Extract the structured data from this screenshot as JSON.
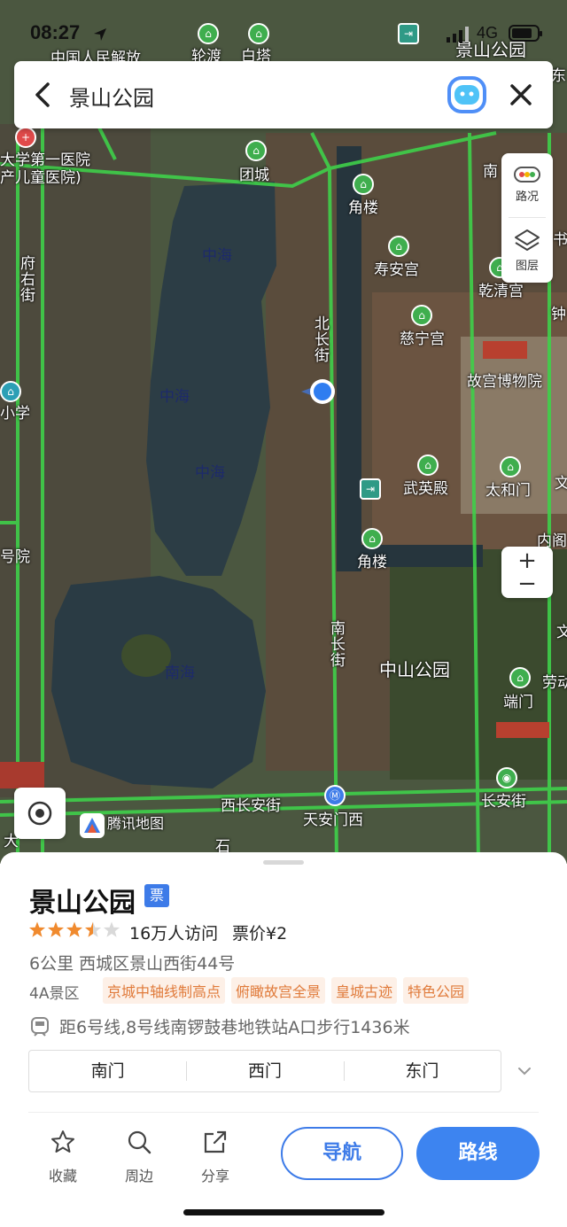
{
  "status_bar": {
    "time": "08:27",
    "network": "4G"
  },
  "search": {
    "query": "景山公园"
  },
  "map_controls": {
    "traffic_label": "路况",
    "layers_label": "图层",
    "zoom_in": "+",
    "zoom_out": "−"
  },
  "map": {
    "watermark": "腾讯地图",
    "labels": {
      "top1": "中国人民解放",
      "top2": "轮渡",
      "top3": "白塔",
      "top4": "景山公园",
      "top_right": "东",
      "hospital": "大学第一医院",
      "hospital2": "产儿童医院)",
      "tuancheng": "团城",
      "fuyou": "府右街",
      "school": "小学",
      "hao": "号院",
      "zhonghai1": "中海",
      "zhonghai2": "中海",
      "zhonghai3": "中海",
      "nanhai": "南海",
      "beichang": "北长街",
      "nanchang": "南长街",
      "jiaolou1": "角楼",
      "jiaolou2": "角楼",
      "shouan": "寿安宫",
      "qianqing": "乾清宫",
      "cining": "慈宁宫",
      "palace": "故宫博物院",
      "wuying": "武英殿",
      "taihe": "太和门",
      "zhongshan": "中山公园",
      "duanmen": "端门",
      "xichangan": "西长安街",
      "tiananmen_w": "天安门西",
      "changan": "长安街",
      "nan": "南",
      "shu": "书",
      "zhong": "钟",
      "wen": "文",
      "neige": "内阁",
      "laodong": "劳动",
      "dajie": "大",
      "shi": "石",
      "wen2": "文"
    }
  },
  "place": {
    "name": "景山公园",
    "ticket_badge": "票",
    "rating": 3.5,
    "visits": "16万人访问",
    "price": "票价¥2",
    "address": "6公里  西城区景山西街44号",
    "level": "4A景区",
    "tags": [
      "京城中轴线制高点",
      "俯瞰故宫全景",
      "皇城古迹",
      "特色公园"
    ],
    "metro": "距6号线,8号线南锣鼓巷地铁站A口步行1436米",
    "gates": [
      "南门",
      "西门",
      "东门"
    ]
  },
  "actions": {
    "favorite": "收藏",
    "nearby": "周边",
    "share": "分享",
    "navigate": "导航",
    "route": "路线"
  },
  "colors": {
    "accent": "#3d7be8",
    "tag_orange": "#e07a3a",
    "poi_green": "#3fae4e",
    "road_green": "#3fd04a"
  }
}
